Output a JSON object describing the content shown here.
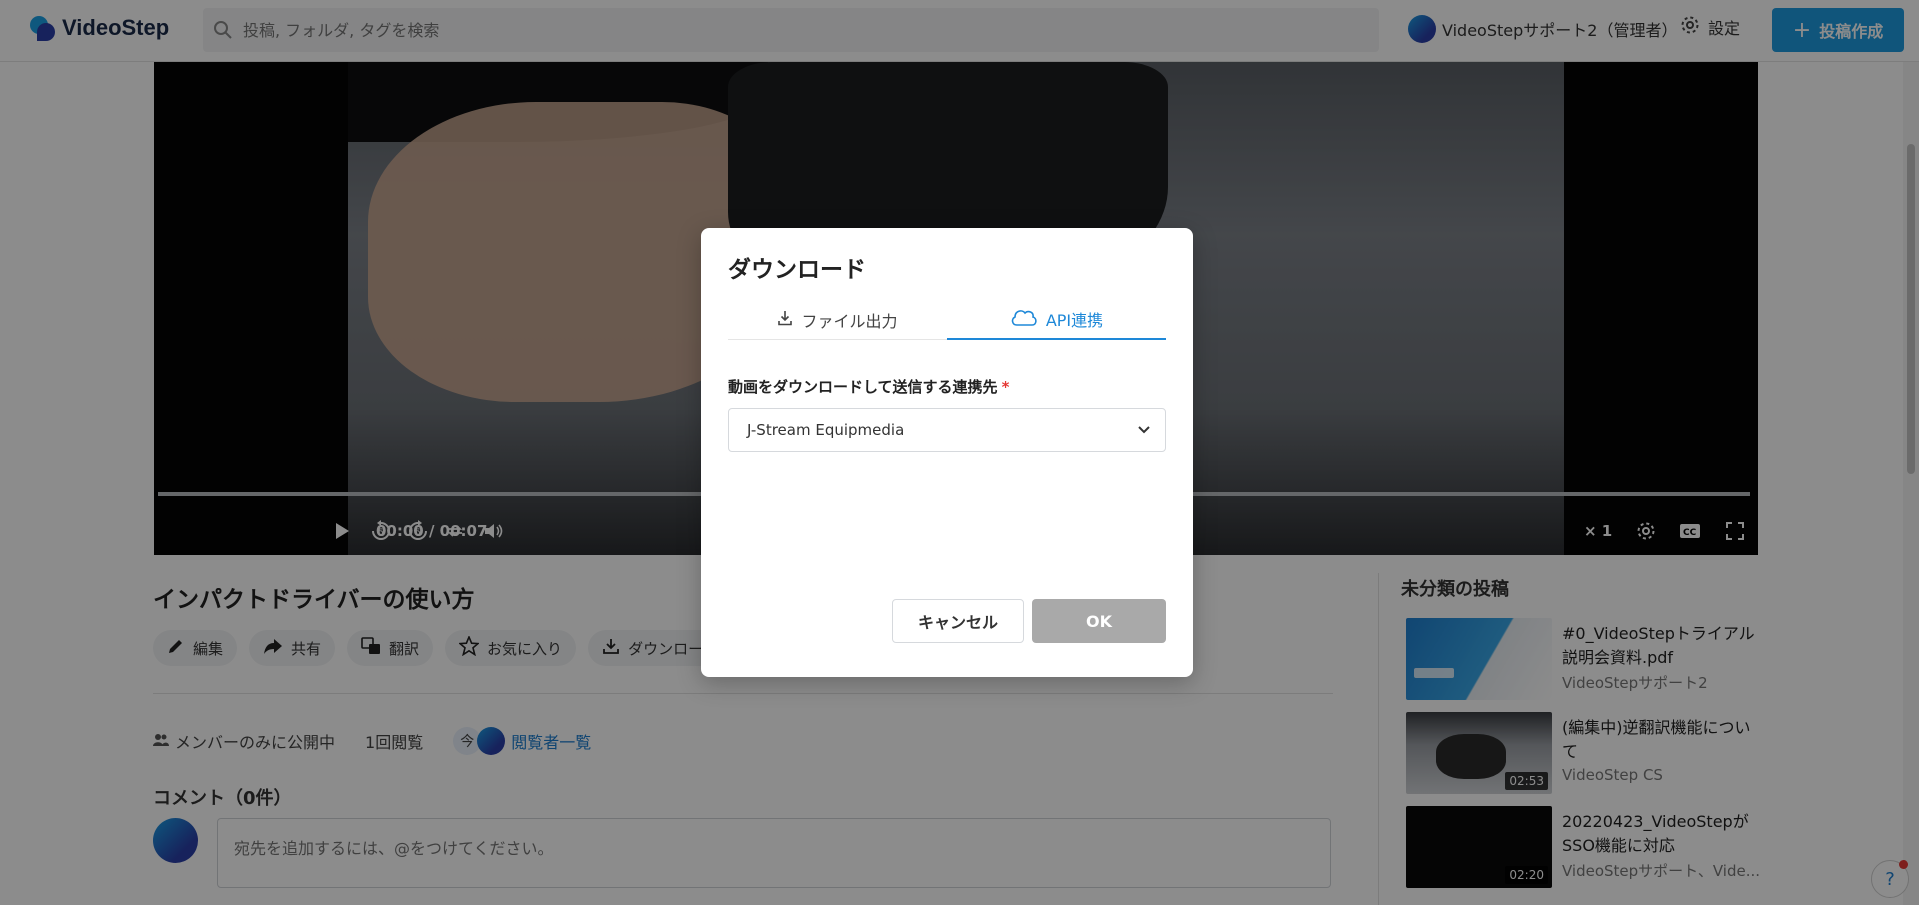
{
  "header": {
    "logo_text": "VideoStep",
    "search_placeholder": "投稿, フォルダ, タグを検索",
    "user_name": "VideoStepサポート2（管理者）",
    "settings_label": "設定",
    "create_label": "投稿作成"
  },
  "video": {
    "time": "00:00 / 00:07",
    "speed": "× 1",
    "progress": 0
  },
  "post": {
    "title": "インパクトドライバーの使い方",
    "actions": [
      {
        "label": "編集",
        "icon": "pencil-icon"
      },
      {
        "label": "共有",
        "icon": "share-icon"
      },
      {
        "label": "翻訳",
        "icon": "translate-icon"
      },
      {
        "label": "お気に入り",
        "icon": "star-icon"
      },
      {
        "label": "ダウンロード",
        "icon": "download-icon"
      }
    ],
    "visibility": "メンバーのみに公開中",
    "views": "1回閲覧",
    "now_label": "今",
    "viewers_link": "閲覧者一覧",
    "comments_heading": "コメント（0件）",
    "comment_placeholder": "宛先を追加するには、@をつけてください。"
  },
  "sidebar": {
    "heading": "未分類の投稿",
    "items": [
      {
        "title": "#0_VideoStepトライアル説明会資料.pdf",
        "author": "VideoStepサポート2",
        "duration": ""
      },
      {
        "title": "(編集中)逆翻訳機能について",
        "author": "VideoStep CS",
        "duration": "02:53"
      },
      {
        "title": "20220423_VideoStepがSSO機能に対応",
        "author": "VideoStepサポート、Vide...",
        "duration": "02:20"
      }
    ]
  },
  "modal": {
    "title": "ダウンロード",
    "tabs": [
      {
        "label": "ファイル出力",
        "icon": "download-icon"
      },
      {
        "label": "API連携",
        "icon": "cloud-icon"
      }
    ],
    "active_tab": "API連携",
    "field_label": "動画をダウンロードして送信する連携先",
    "required_mark": "*",
    "selected_value": "J-Stream Equipmedia",
    "cancel_label": "キャンセル",
    "ok_label": "OK"
  },
  "colors": {
    "accent": "#1e88d8",
    "create_button": "#1e9be0",
    "ok_disabled": "#a9a9a9",
    "required": "#e53935"
  }
}
